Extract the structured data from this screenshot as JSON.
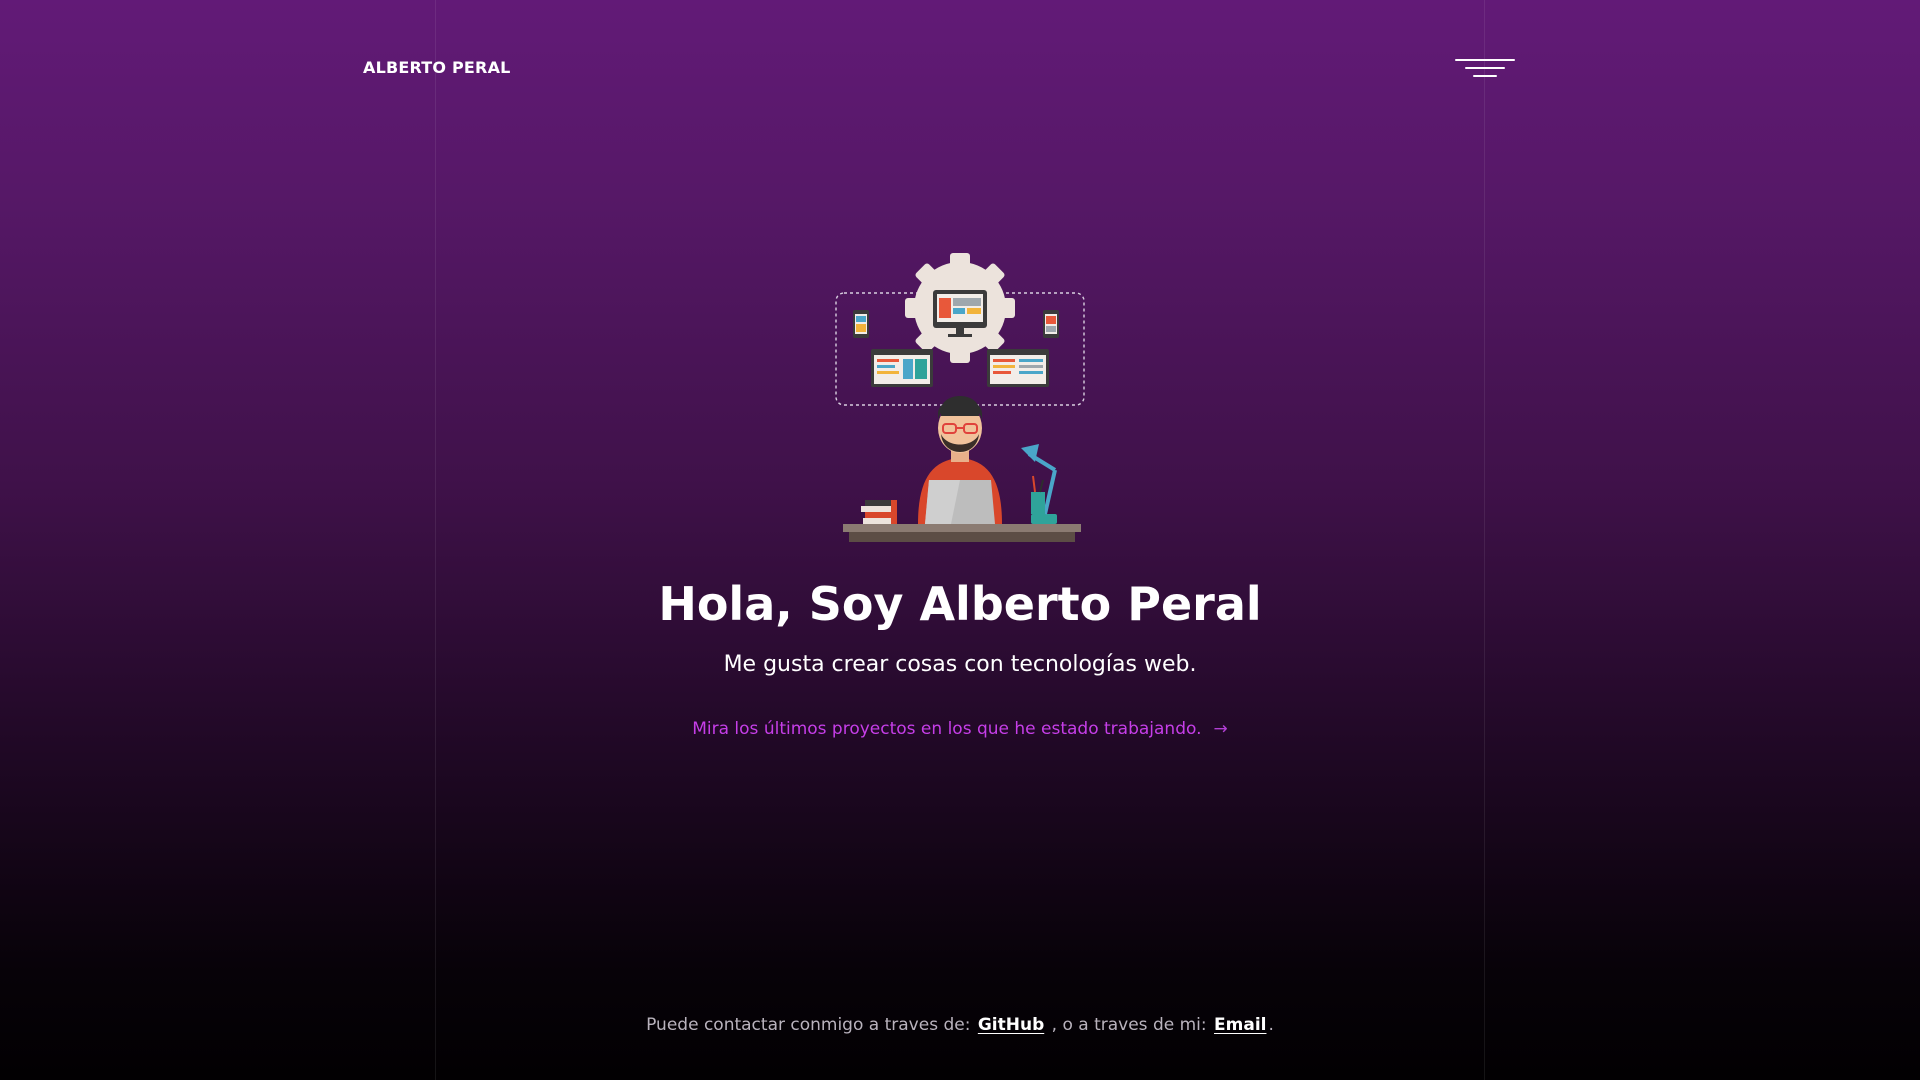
{
  "header": {
    "brand": "ALBERTO PERAL",
    "menu_icon": "hamburger-menu-icon"
  },
  "hero": {
    "illustration": "developer-at-desk-illustration",
    "title": "Hola, Soy Alberto Peral",
    "subtitle": "Me gusta crear cosas con tecnologías web.",
    "projects_link": "Mira los últimos proyectos en los que he estado trabajando.",
    "projects_arrow_icon": "arrow-right-icon"
  },
  "footer": {
    "contact_prefix": "Puede contactar conmigo a traves de:",
    "github_label": "GitHub",
    "contact_middle": ", o a traves de mi:",
    "email_label": "Email",
    "contact_suffix": "."
  },
  "colors": {
    "background_top": "#621a77",
    "background_bottom": "#020002",
    "accent_link": "#c63ee8",
    "text": "#ffffff",
    "muted_text": "#b9b3bd"
  }
}
